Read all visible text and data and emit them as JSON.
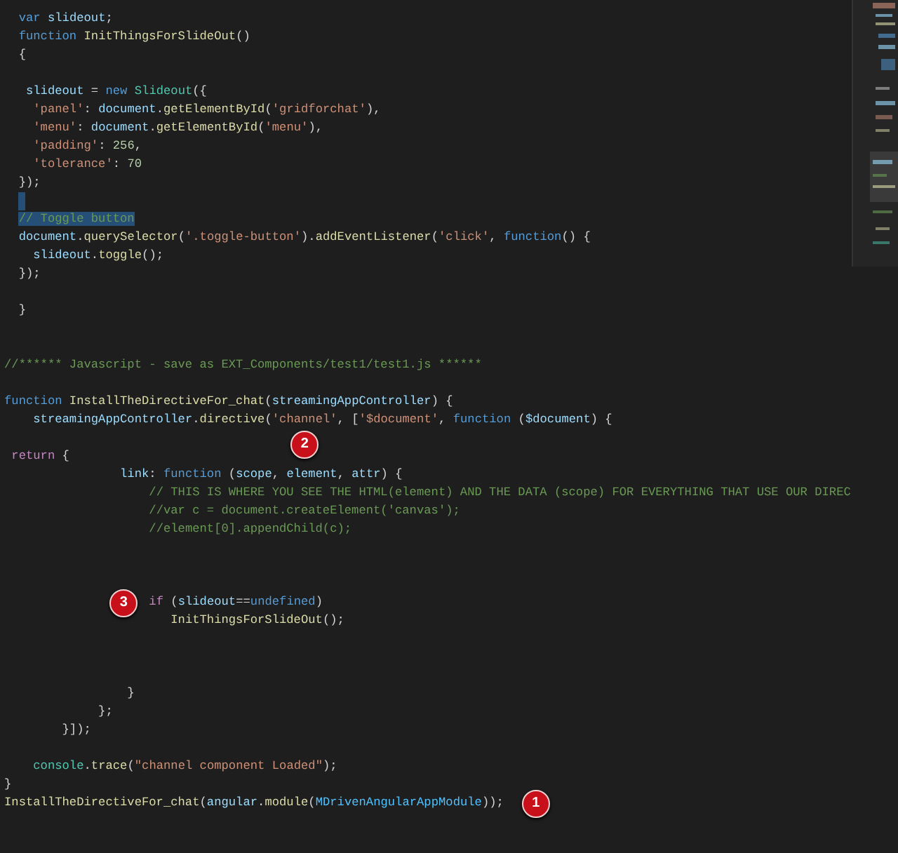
{
  "editor": {
    "lines": [
      {
        "kind": "code",
        "selected": false,
        "tokens": [
          {
            "kind": "kw",
            "text": "  var"
          },
          {
            "kind": "var",
            "text": " slideout"
          },
          {
            "kind": "pun",
            "text": ";"
          }
        ]
      },
      {
        "kind": "code",
        "selected": false,
        "tokens": [
          {
            "kind": "kw",
            "text": "  function"
          },
          {
            "kind": "fn",
            "text": " InitThingsForSlideOut"
          },
          {
            "kind": "pun",
            "text": "()"
          }
        ]
      },
      {
        "kind": "code",
        "selected": false,
        "tokens": [
          {
            "kind": "pun",
            "text": "  {"
          }
        ]
      },
      {
        "kind": "blank"
      },
      {
        "kind": "code",
        "selected": false,
        "tokens": [
          {
            "kind": "var",
            "text": "   slideout"
          },
          {
            "kind": "pun",
            "text": " = "
          },
          {
            "kind": "kw",
            "text": "new"
          },
          {
            "kind": "cls",
            "text": " Slideout"
          },
          {
            "kind": "pun",
            "text": "({"
          }
        ]
      },
      {
        "kind": "code",
        "selected": false,
        "tokens": [
          {
            "kind": "str",
            "text": "    'panel'"
          },
          {
            "kind": "pun",
            "text": ": "
          },
          {
            "kind": "var",
            "text": "document"
          },
          {
            "kind": "pun",
            "text": "."
          },
          {
            "kind": "fn",
            "text": "getElementById"
          },
          {
            "kind": "pun",
            "text": "("
          },
          {
            "kind": "str",
            "text": "'gridforchat'"
          },
          {
            "kind": "pun",
            "text": "),"
          }
        ]
      },
      {
        "kind": "code",
        "selected": false,
        "tokens": [
          {
            "kind": "str",
            "text": "    'menu'"
          },
          {
            "kind": "pun",
            "text": ": "
          },
          {
            "kind": "var",
            "text": "document"
          },
          {
            "kind": "pun",
            "text": "."
          },
          {
            "kind": "fn",
            "text": "getElementById"
          },
          {
            "kind": "pun",
            "text": "("
          },
          {
            "kind": "str",
            "text": "'menu'"
          },
          {
            "kind": "pun",
            "text": "),"
          }
        ]
      },
      {
        "kind": "code",
        "selected": false,
        "tokens": [
          {
            "kind": "str",
            "text": "    'padding'"
          },
          {
            "kind": "pun",
            "text": ": "
          },
          {
            "kind": "num",
            "text": "256"
          },
          {
            "kind": "pun",
            "text": ","
          }
        ]
      },
      {
        "kind": "code",
        "selected": false,
        "tokens": [
          {
            "kind": "str",
            "text": "    'tolerance'"
          },
          {
            "kind": "pun",
            "text": ": "
          },
          {
            "kind": "num",
            "text": "70"
          }
        ]
      },
      {
        "kind": "code",
        "selected": false,
        "tokens": [
          {
            "kind": "pun",
            "text": "  });"
          }
        ]
      },
      {
        "kind": "blank",
        "selected": true
      },
      {
        "kind": "code",
        "selected": true,
        "tokens": [
          {
            "kind": "cm",
            "text": "  // Toggle button"
          }
        ]
      },
      {
        "kind": "code",
        "selected": false,
        "tokens": [
          {
            "kind": "var",
            "text": "  document"
          },
          {
            "kind": "pun",
            "text": "."
          },
          {
            "kind": "fn",
            "text": "querySelector"
          },
          {
            "kind": "pun",
            "text": "("
          },
          {
            "kind": "str",
            "text": "'.toggle-button'"
          },
          {
            "kind": "pun",
            "text": ")."
          },
          {
            "kind": "fn",
            "text": "addEventListener"
          },
          {
            "kind": "pun",
            "text": "("
          },
          {
            "kind": "str",
            "text": "'click'"
          },
          {
            "kind": "pun",
            "text": ", "
          },
          {
            "kind": "kw",
            "text": "function"
          },
          {
            "kind": "pun",
            "text": "() {"
          }
        ]
      },
      {
        "kind": "code",
        "selected": false,
        "tokens": [
          {
            "kind": "var",
            "text": "    slideout"
          },
          {
            "kind": "pun",
            "text": "."
          },
          {
            "kind": "fn",
            "text": "toggle"
          },
          {
            "kind": "pun",
            "text": "();"
          }
        ]
      },
      {
        "kind": "code",
        "selected": false,
        "tokens": [
          {
            "kind": "pun",
            "text": "  });"
          }
        ]
      },
      {
        "kind": "blank"
      },
      {
        "kind": "code",
        "selected": false,
        "tokens": [
          {
            "kind": "pun",
            "text": "  }"
          }
        ]
      },
      {
        "kind": "blank"
      },
      {
        "kind": "blank"
      },
      {
        "kind": "code",
        "selected": false,
        "tokens": [
          {
            "kind": "cm",
            "text": "//****** Javascript - save as EXT_Components/test1/test1.js ******"
          }
        ]
      },
      {
        "kind": "blank"
      },
      {
        "kind": "code",
        "selected": false,
        "tokens": [
          {
            "kind": "kw",
            "text": "function"
          },
          {
            "kind": "fn",
            "text": " InstallTheDirectiveFor_chat"
          },
          {
            "kind": "pun",
            "text": "("
          },
          {
            "kind": "var",
            "text": "streamingAppController"
          },
          {
            "kind": "pun",
            "text": ") {"
          }
        ]
      },
      {
        "kind": "code",
        "selected": false,
        "tokens": [
          {
            "kind": "var",
            "text": "    streamingAppController"
          },
          {
            "kind": "pun",
            "text": "."
          },
          {
            "kind": "fn",
            "text": "directive"
          },
          {
            "kind": "pun",
            "text": "("
          },
          {
            "kind": "str",
            "text": "'channel'",
            "badge": "2"
          },
          {
            "kind": "pun",
            "text": ", ["
          },
          {
            "kind": "str",
            "text": "'$document'"
          },
          {
            "kind": "pun",
            "text": ", "
          },
          {
            "kind": "kw",
            "text": "function"
          },
          {
            "kind": "pun",
            "text": " ("
          },
          {
            "kind": "var",
            "text": "$document"
          },
          {
            "kind": "pun",
            "text": ") {"
          }
        ]
      },
      {
        "kind": "blank"
      },
      {
        "kind": "code",
        "selected": false,
        "tokens": [
          {
            "kind": "ctl",
            "text": " return"
          },
          {
            "kind": "pun",
            "text": " {"
          }
        ]
      },
      {
        "kind": "code",
        "selected": false,
        "tokens": [
          {
            "kind": "var",
            "text": "                link"
          },
          {
            "kind": "pun",
            "text": ": "
          },
          {
            "kind": "kw",
            "text": "function"
          },
          {
            "kind": "pun",
            "text": " ("
          },
          {
            "kind": "var",
            "text": "scope"
          },
          {
            "kind": "pun",
            "text": ", "
          },
          {
            "kind": "var",
            "text": "element"
          },
          {
            "kind": "pun",
            "text": ", "
          },
          {
            "kind": "var",
            "text": "attr"
          },
          {
            "kind": "pun",
            "text": ") {"
          }
        ]
      },
      {
        "kind": "code",
        "selected": false,
        "tokens": [
          {
            "kind": "cm",
            "text": "                    // THIS IS WHERE YOU SEE THE HTML(element) AND THE DATA (scope) FOR EVERYTHING THAT USE OUR DIREC"
          }
        ]
      },
      {
        "kind": "code",
        "selected": false,
        "tokens": [
          {
            "kind": "cm",
            "text": "                    //var c = document.createElement('canvas');"
          }
        ]
      },
      {
        "kind": "code",
        "selected": false,
        "tokens": [
          {
            "kind": "cm",
            "text": "                    //element[0].appendChild(c);"
          }
        ]
      },
      {
        "kind": "blank"
      },
      {
        "kind": "blank"
      },
      {
        "kind": "blank"
      },
      {
        "kind": "code",
        "selected": false,
        "tokens": [
          {
            "kind": "ctl",
            "text": "                    if",
            "badge": "3"
          },
          {
            "kind": "pun",
            "text": " ("
          },
          {
            "kind": "var",
            "text": "slideout"
          },
          {
            "kind": "pun",
            "text": "=="
          },
          {
            "kind": "kw",
            "text": "undefined"
          },
          {
            "kind": "pun",
            "text": ")"
          }
        ]
      },
      {
        "kind": "code",
        "selected": false,
        "tokens": [
          {
            "kind": "fn",
            "text": "                       InitThingsForSlideOut"
          },
          {
            "kind": "pun",
            "text": "();"
          }
        ]
      },
      {
        "kind": "blank"
      },
      {
        "kind": "blank"
      },
      {
        "kind": "blank"
      },
      {
        "kind": "code",
        "selected": false,
        "tokens": [
          {
            "kind": "pun",
            "text": "                 }"
          }
        ]
      },
      {
        "kind": "code",
        "selected": false,
        "tokens": [
          {
            "kind": "pun",
            "text": "             };"
          }
        ]
      },
      {
        "kind": "code",
        "selected": false,
        "tokens": [
          {
            "kind": "pun",
            "text": "        }]);"
          }
        ]
      },
      {
        "kind": "blank"
      },
      {
        "kind": "code",
        "selected": false,
        "tokens": [
          {
            "kind": "cls",
            "text": "    console"
          },
          {
            "kind": "pun",
            "text": "."
          },
          {
            "kind": "fn",
            "text": "trace"
          },
          {
            "kind": "pun",
            "text": "("
          },
          {
            "kind": "str",
            "text": "\"channel component Loaded\""
          },
          {
            "kind": "pun",
            "text": ");"
          }
        ]
      },
      {
        "kind": "code",
        "selected": false,
        "tokens": [
          {
            "kind": "pun",
            "text": "}"
          }
        ]
      },
      {
        "kind": "code",
        "selected": false,
        "tokens": [
          {
            "kind": "fn",
            "text": "InstallTheDirectiveFor_chat"
          },
          {
            "kind": "pun",
            "text": "("
          },
          {
            "kind": "var",
            "text": "angular"
          },
          {
            "kind": "pun",
            "text": "."
          },
          {
            "kind": "fn",
            "text": "module"
          },
          {
            "kind": "pun",
            "text": "("
          },
          {
            "kind": "const",
            "text": "MDrivenAngularAppModule"
          },
          {
            "kind": "pun",
            "text": "));",
            "badge": "1"
          }
        ]
      }
    ]
  }
}
